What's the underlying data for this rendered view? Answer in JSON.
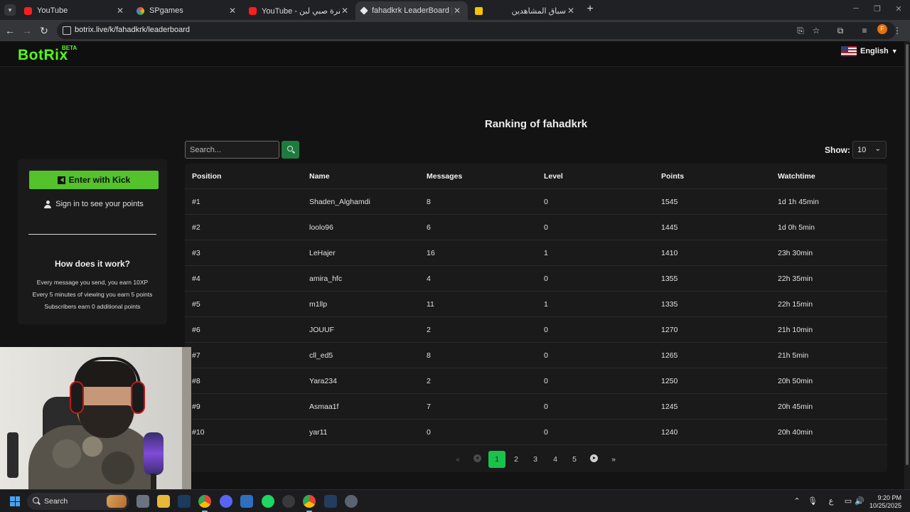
{
  "browser": {
    "tabs": [
      {
        "title": "YouTube",
        "favicon": "youtube-icon",
        "active": false
      },
      {
        "title": "SPgames",
        "favicon": "spgames-icon",
        "active": false
      },
      {
        "title": "YouTube - اغنية يا بقرة صبي لبن",
        "favicon": "youtube-icon",
        "active": false
      },
      {
        "title": "fahadkrk LeaderBoard | The bes",
        "favicon": "kick-icon",
        "active": true
      },
      {
        "title": "سباق المشاهدين",
        "favicon": "bd-icon",
        "active": false
      }
    ],
    "url": "botrix.live/k/fahadkrk/leaderboard",
    "profile_initial": "F"
  },
  "site": {
    "logo": "BotRix",
    "beta": "BETA",
    "language": "English"
  },
  "ranking": {
    "title": "Ranking of fahadkrk",
    "search_placeholder": "Search...",
    "show_label": "Show:",
    "show_value": "10"
  },
  "sidebar": {
    "kick_button": "Enter with Kick",
    "signin": "Sign in to see your points",
    "how_title": "How does it work?",
    "how_lines": [
      "Every message you send, you earn 10XP",
      "Every 5 minutes of viewing you earn 5 points",
      "Subscribers earn 0 additional points"
    ]
  },
  "table": {
    "headers": [
      "Position",
      "Name",
      "Messages",
      "Level",
      "Points",
      "Watchtime"
    ],
    "rows": [
      [
        "#1",
        "Shaden_Alghamdi",
        "8",
        "0",
        "1545",
        "1d 1h 45min"
      ],
      [
        "#2",
        "loolo96",
        "6",
        "0",
        "1445",
        "1d 0h 5min"
      ],
      [
        "#3",
        "LeHajer",
        "16",
        "1",
        "1410",
        "23h 30min"
      ],
      [
        "#4",
        "amira_hfc",
        "4",
        "0",
        "1355",
        "22h 35min"
      ],
      [
        "#5",
        "m1llp",
        "11",
        "1",
        "1335",
        "22h 15min"
      ],
      [
        "#6",
        "JOUUF",
        "2",
        "0",
        "1270",
        "21h 10min"
      ],
      [
        "#7",
        "cll_ed5",
        "8",
        "0",
        "1265",
        "21h 5min"
      ],
      [
        "#8",
        "Yara234",
        "2",
        "0",
        "1250",
        "20h 50min"
      ],
      [
        "#9",
        "Asmaa1f",
        "7",
        "0",
        "1245",
        "20h 45min"
      ],
      [
        "#10",
        "yar11",
        "0",
        "0",
        "1240",
        "20h 40min"
      ]
    ]
  },
  "pagination": {
    "first": "«",
    "last": "»",
    "pages": [
      "1",
      "2",
      "3",
      "4",
      "5"
    ],
    "current": "1"
  },
  "taskbar": {
    "search_label": "Search",
    "time": "9:20 PM",
    "date": "10/25/2025",
    "lang_indicator": "ع"
  },
  "colors": {
    "brand_green": "#53fc18",
    "accent_green": "#19c24a",
    "page_bg": "#131313"
  }
}
